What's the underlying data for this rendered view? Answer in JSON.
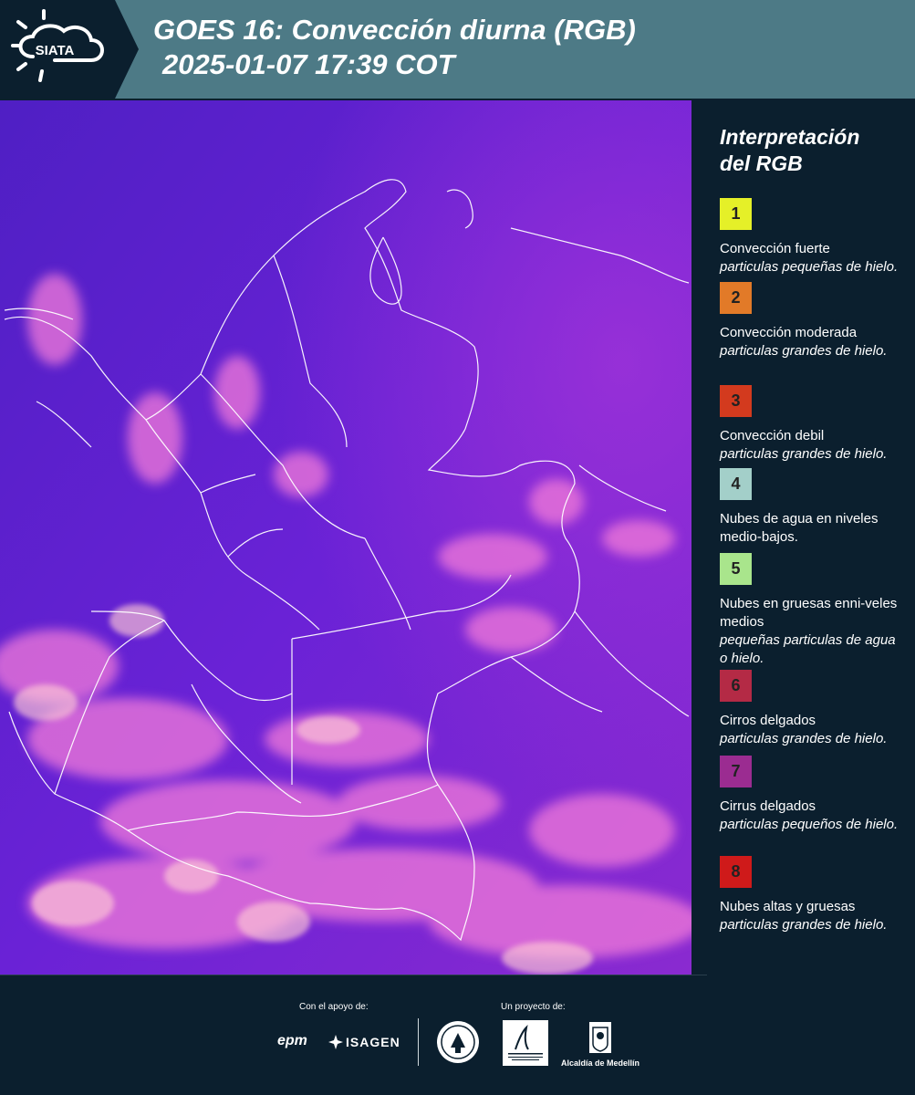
{
  "header": {
    "logo_text": "SIATA",
    "title_line1": "GOES 16: Convección diurna (RGB)",
    "title_line2": "2025-01-07 17:39 COT",
    "background": "#4d7a86"
  },
  "legend": {
    "title_line1": "Interpretación",
    "title_line2": "del RGB",
    "items": [
      {
        "number": "1",
        "color": "#e5f028",
        "label": "Convección fuerte",
        "sub": "particulas pequeñas de hielo."
      },
      {
        "number": "2",
        "color": "#e27a28",
        "label": "Convección moderada",
        "sub": "particulas grandes de hielo."
      },
      {
        "number": "3",
        "color": "#d33a1e",
        "label": "Convección debil",
        "sub": "particulas grandes de hielo."
      },
      {
        "number": "4",
        "color": "#a3cfc9",
        "label": "Nubes de agua en niveles medio-bajos.",
        "sub": ""
      },
      {
        "number": "5",
        "color": "#a9e58c",
        "label": "Nubes en gruesas enni-veles medios",
        "sub": "pequeñas particulas de agua o hielo."
      },
      {
        "number": "6",
        "color": "#b42a45",
        "label": "Cirros delgados",
        "sub": "particulas grandes de hielo."
      },
      {
        "number": "7",
        "color": "#9b2c91",
        "label": "Cirrus delgados",
        "sub": "particulas pequeños de hielo."
      },
      {
        "number": "8",
        "color": "#cf1a1a",
        "label": "Nubes altas y gruesas",
        "sub": "particulas grandes de hielo."
      }
    ]
  },
  "footer": {
    "support_label": "Con el apoyo de:",
    "project_label": "Un proyecto de:",
    "sponsors": [
      "epm",
      "ISAGEN"
    ],
    "partners": [
      "Área Metropolitana Valle de Aburrá",
      "Alcaldía de Medellín"
    ]
  },
  "map": {
    "base_color": "#5c20cc",
    "cloud_color": "#f27ad9",
    "border_color": "#ffffff"
  }
}
